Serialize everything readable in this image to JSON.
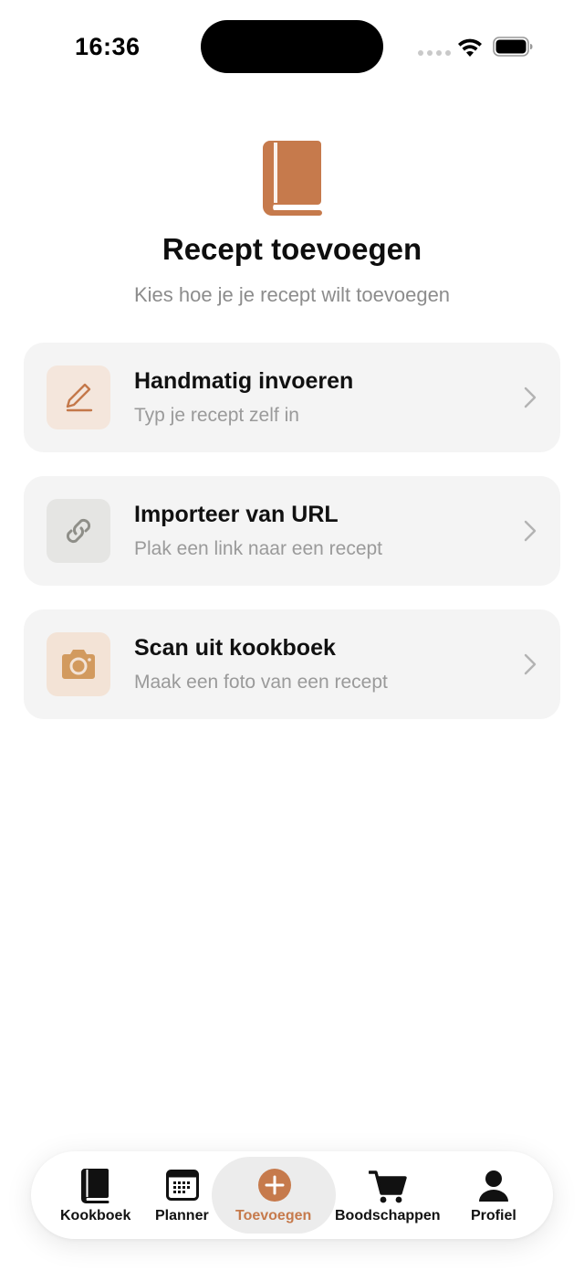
{
  "status_bar": {
    "time": "16:36"
  },
  "header": {
    "icon": "book-icon",
    "title": "Recept toevoegen",
    "subtitle": "Kies hoe je je recept wilt toevoegen"
  },
  "options": [
    {
      "icon": "pencil-icon",
      "title": "Handmatig invoeren",
      "description": "Typ je recept zelf in",
      "icon_bg": "#f4e6dc",
      "icon_color": "#c4784a"
    },
    {
      "icon": "link-icon",
      "title": "Importeer van URL",
      "description": "Plak een link naar een recept",
      "icon_bg": "#e5e5e3",
      "icon_color": "#8e8e88"
    },
    {
      "icon": "camera-icon",
      "title": "Scan uit kookboek",
      "description": "Maak een foto van een recept",
      "icon_bg": "#f3e3d6",
      "icon_color": "#d29a5e"
    }
  ],
  "tab_bar": {
    "active": "Toevoegen",
    "items": [
      {
        "label": "Kookboek",
        "icon": "book-icon"
      },
      {
        "label": "Planner",
        "icon": "calendar-icon"
      },
      {
        "label": "Toevoegen",
        "icon": "plus-circle-icon"
      },
      {
        "label": "Boodschappen",
        "icon": "cart-icon"
      },
      {
        "label": "Profiel",
        "icon": "person-icon"
      }
    ]
  },
  "colors": {
    "accent": "#c67a4c",
    "card_bg": "#f4f4f4",
    "secondary_text": "#8c8c8c"
  }
}
